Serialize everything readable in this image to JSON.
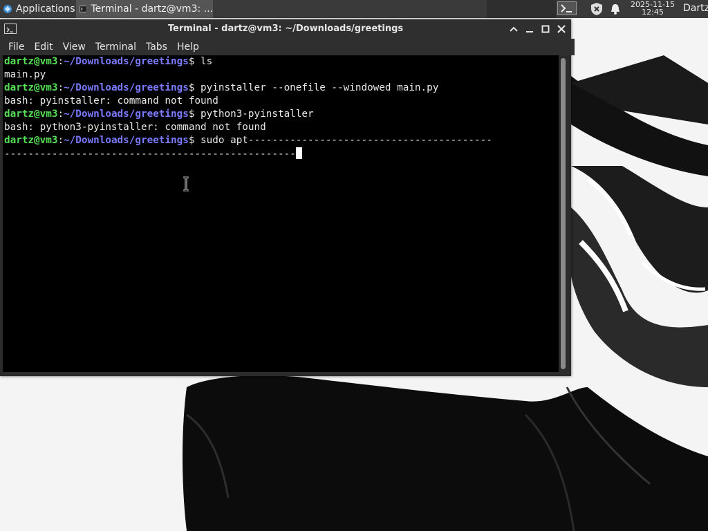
{
  "panel": {
    "apps_label": "Applications",
    "task_label": "Terminal - dartz@vm3: ...",
    "clock_date": "2025-11-15",
    "clock_time": "12:45",
    "user": "Dartz"
  },
  "window": {
    "title": "Terminal - dartz@vm3: ~/Downloads/greetings",
    "menu": [
      "File",
      "Edit",
      "View",
      "Terminal",
      "Tabs",
      "Help"
    ]
  },
  "terminal": {
    "user_host": "dartz@vm3",
    "path": "~/Downloads/greetings",
    "prompt_suffix": "$ ",
    "lines": [
      {
        "type": "prompt",
        "cmd": "ls"
      },
      {
        "type": "out",
        "text": "main.py"
      },
      {
        "type": "prompt",
        "cmd": "pyinstaller --onefile --windowed main.py"
      },
      {
        "type": "out",
        "text": "bash: pyinstaller: command not found"
      },
      {
        "type": "prompt",
        "cmd": "python3-pyinstaller"
      },
      {
        "type": "out",
        "text": "bash: python3-pyinstaller: command not found"
      },
      {
        "type": "prompt",
        "cmd": "sudo apt-----------------------------------------"
      },
      {
        "type": "out",
        "text": "-------------------------------------------------",
        "cursor": true
      }
    ]
  },
  "icons": {
    "panel_logo": "xfce-logo-icon",
    "terminal": "terminal-icon",
    "shield": "shield-icon",
    "bell": "bell-icon",
    "minimize": "minimize-icon",
    "maximize": "maximize-icon",
    "close": "close-icon",
    "ibeam": "text-cursor-icon"
  },
  "colors": {
    "panel_bg": "#3a3a3a",
    "terminal_bg": "#000000",
    "user_host": "#55e055",
    "path": "#7b7bff"
  }
}
